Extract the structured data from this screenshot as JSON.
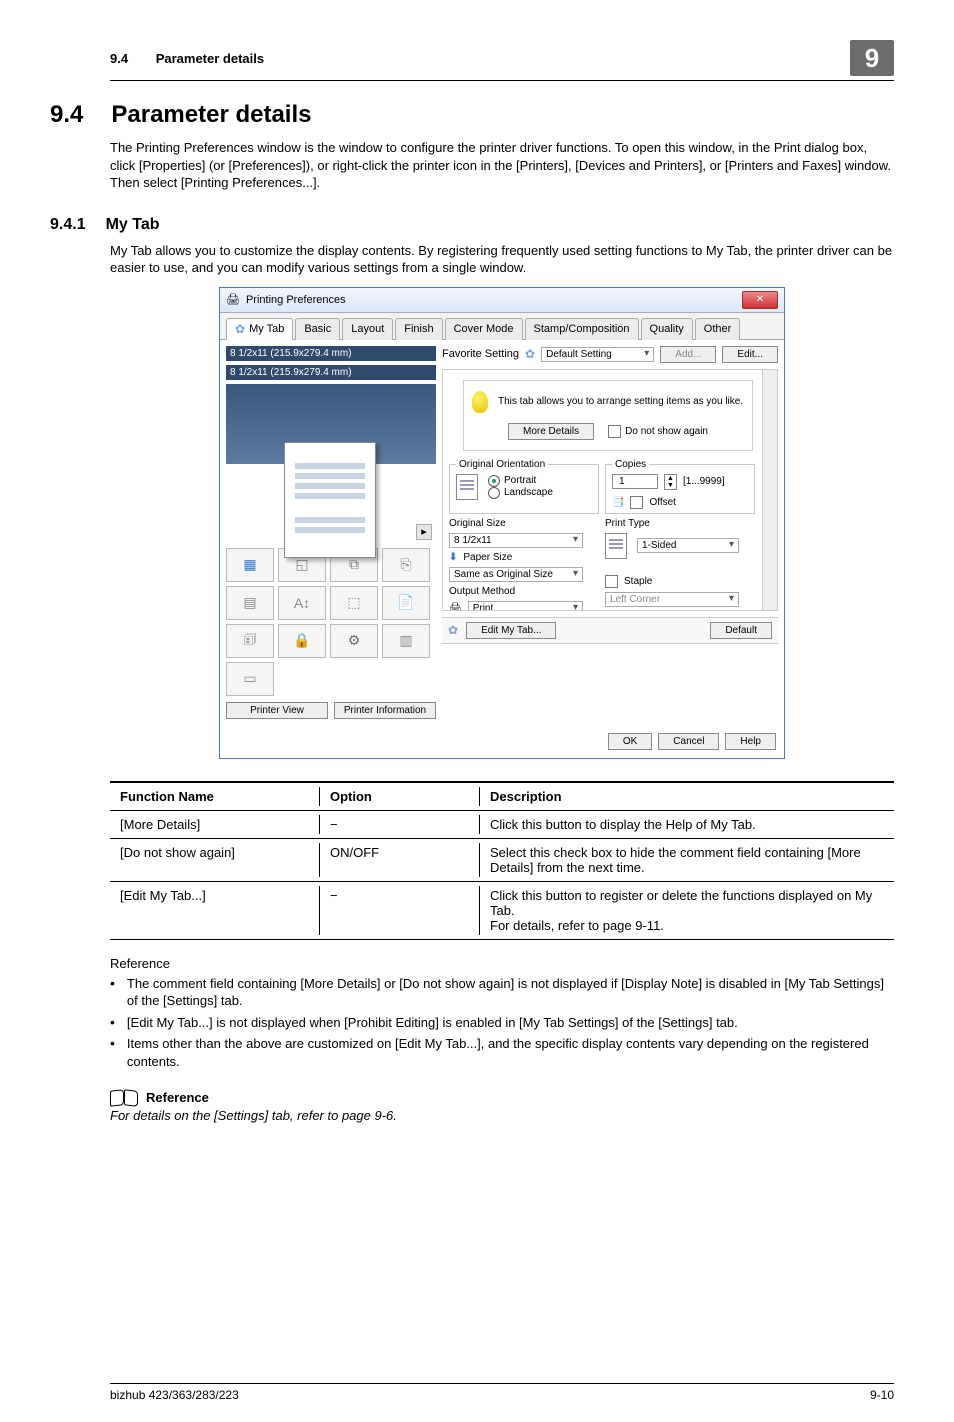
{
  "header": {
    "secnum": "9.4",
    "title": "Parameter details",
    "chapter": "9"
  },
  "section": {
    "num": "9.4",
    "title": "Parameter details",
    "intro": "The Printing Preferences window is the window to configure the printer driver functions. To open this window, in the Print dialog box, click [Properties] (or [Preferences]), or right-click the printer icon in the [Printers], [Devices and Printers], or [Printers and Faxes] window. Then select [Printing Preferences...]."
  },
  "subsection": {
    "num": "9.4.1",
    "title": "My Tab",
    "intro": "My Tab allows you to customize the display contents. By registering frequently used setting functions to My Tab, the printer driver can be easier to use, and you can modify various settings from a single window."
  },
  "dialog": {
    "title": "Printing Preferences",
    "tabs": {
      "mytab": "My Tab",
      "basic": "Basic",
      "layout": "Layout",
      "finish": "Finish",
      "cover": "Cover Mode",
      "stamp": "Stamp/Composition",
      "quality": "Quality",
      "other": "Other"
    },
    "dims1": "8 1/2x11 (215.9x279.4 mm)",
    "dims2": "8 1/2x11 (215.9x279.4 mm)",
    "leftbtns": {
      "view": "Printer View",
      "info": "Printer Information"
    },
    "fav": {
      "label": "Favorite Setting",
      "value": "Default Setting",
      "add": "Add...",
      "edit": "Edit..."
    },
    "tip": {
      "text": "This tab allows you to arrange setting items as you like.",
      "more": "More Details",
      "dontshow": "Do not show again"
    },
    "orient": {
      "legend": "Original Orientation",
      "portrait": "Portrait",
      "landscape": "Landscape"
    },
    "copies": {
      "legend": "Copies",
      "value": "1",
      "range": "[1...9999]",
      "offset": "Offset"
    },
    "orig": {
      "label": "Original Size",
      "value": "8 1/2x11"
    },
    "paper": {
      "label": "Paper Size",
      "value": "Same as Original Size"
    },
    "ptype": {
      "label": "Print Type",
      "value": "1-Sided"
    },
    "output": {
      "label": "Output Method",
      "value": "Print"
    },
    "staple": {
      "label": "Staple",
      "value": "Left Corner"
    },
    "editbar": {
      "edit": "Edit My Tab...",
      "default": "Default"
    },
    "footer": {
      "ok": "OK",
      "cancel": "Cancel",
      "help": "Help"
    }
  },
  "table": {
    "head": {
      "fn": "Function Name",
      "opt": "Option",
      "desc": "Description"
    },
    "rows": [
      {
        "fn": "[More Details]",
        "opt": "−",
        "desc": "Click this button to display the Help of My Tab."
      },
      {
        "fn": "[Do not show again]",
        "opt": "ON/OFF",
        "desc": "Select this check box to hide the comment field containing [More Details] from the next time."
      },
      {
        "fn": "[Edit My Tab...]",
        "opt": "−",
        "desc": "Click this button to register or delete the functions displayed on My Tab.\nFor details, refer to page 9-11."
      }
    ]
  },
  "reference": {
    "heading": "Reference",
    "items": [
      "The comment field containing [More Details] or [Do not show again] is not displayed if [Display Note] is disabled in [My Tab Settings] of the [Settings] tab.",
      "[Edit My Tab...] is not displayed when [Prohibit Editing] is enabled in [My Tab Settings] of the [Settings] tab.",
      "Items other than the above are customized on [Edit My Tab...], and the specific display contents vary depending on the registered contents."
    ],
    "cross_heading": "Reference",
    "cross": "For details on the [Settings] tab, refer to page 9-6."
  },
  "footer": {
    "product": "bizhub 423/363/283/223",
    "page": "9-10"
  }
}
